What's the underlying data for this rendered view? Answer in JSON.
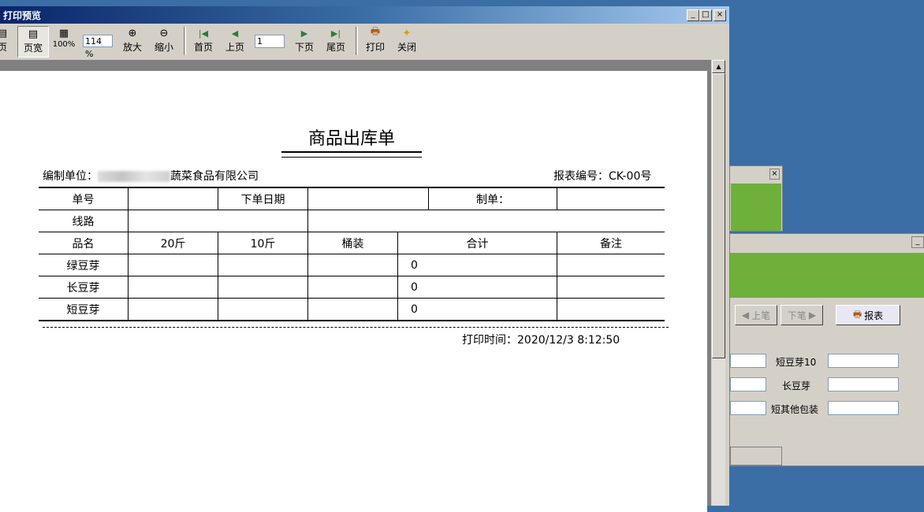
{
  "window": {
    "title": "打印预览"
  },
  "toolbar": {
    "page_label": "页",
    "page_width_label": "页宽",
    "hundred_label": "100%",
    "zoom_value": "114 %",
    "zoom_in_label": "放大",
    "zoom_out_label": "缩小",
    "first_label": "首页",
    "prev_label": "上页",
    "page_number": "1",
    "next_label": "下页",
    "last_label": "尾页",
    "print_label": "打印",
    "close_label": "关闭"
  },
  "report": {
    "title": "商品出库单",
    "unit_label": "编制单位：",
    "unit_value": "蔬菜食品有限公司",
    "report_no": "报表编号：CK-00号",
    "header_row1": [
      "单号",
      "",
      "下单日期",
      "",
      "制单：",
      ""
    ],
    "header_row2": [
      "线路",
      "",
      ""
    ],
    "columns": [
      "品名",
      "20斤",
      "10斤",
      "桶装",
      "合计",
      "备注"
    ],
    "rows": [
      {
        "name": "绿豆芽",
        "total": "0"
      },
      {
        "name": "长豆芽",
        "total": "0"
      },
      {
        "name": "短豆芽",
        "total": "0"
      }
    ],
    "print_time": "打印时间：2020/12/3 8:12:50"
  },
  "background_window": {
    "prev_btn": "上笔",
    "next_btn": "下笔",
    "report_btn": "报表",
    "labels": [
      "短豆芽10",
      "长豆芽",
      "短其他包装"
    ]
  },
  "colors": {
    "title_start": "#0a246a",
    "desktop": "#3a6ea5",
    "green_panel": "#6fb03b"
  }
}
